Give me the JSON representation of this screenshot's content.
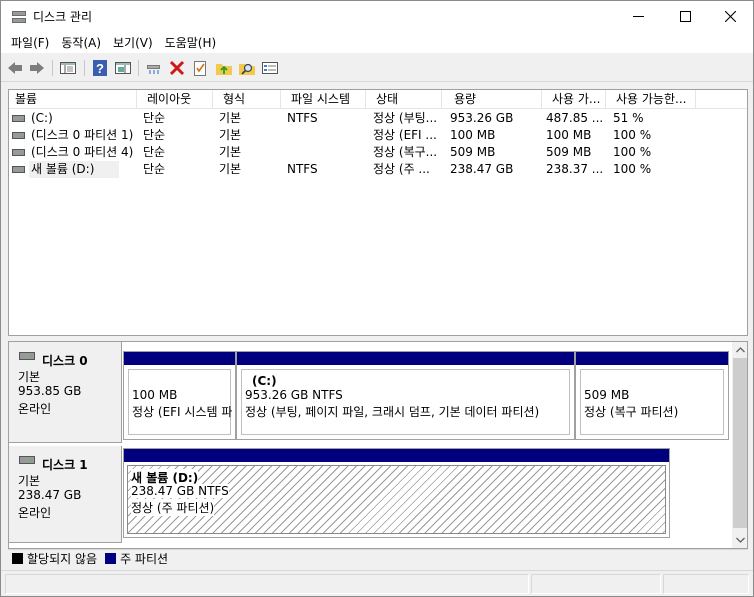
{
  "window": {
    "title": "디스크 관리"
  },
  "menu": [
    "파일(F)",
    "동작(A)",
    "보기(V)",
    "도움말(H)"
  ],
  "toolbar": {
    "buttons": [
      "back-icon",
      "forward-icon",
      "console-tree-icon",
      "help-icon",
      "action-pane-icon",
      "connect-drive-icon",
      "delete-icon",
      "checklist-icon",
      "up-folder-icon",
      "search-icon",
      "properties-icon"
    ]
  },
  "volume_list": {
    "columns": [
      "볼륨",
      "레이아웃",
      "형식",
      "파일 시스템",
      "상태",
      "용량",
      "사용 가...",
      "사용 가능한..."
    ],
    "rows": [
      {
        "volume": "(C:)",
        "layout": "단순",
        "type": "기본",
        "fs": "NTFS",
        "status": "정상 (부팅...",
        "capacity": "953.26 GB",
        "free": "487.85 ...",
        "pct": "51 %"
      },
      {
        "volume": "(디스크 0 파티션 1)",
        "layout": "단순",
        "type": "기본",
        "fs": "",
        "status": "정상 (EFI ...",
        "capacity": "100 MB",
        "free": "100 MB",
        "pct": "100 %"
      },
      {
        "volume": "(디스크 0 파티션 4)",
        "layout": "단순",
        "type": "기본",
        "fs": "",
        "status": "정상 (복구...",
        "capacity": "509 MB",
        "free": "509 MB",
        "pct": "100 %"
      },
      {
        "volume": "새 볼륨 (D:)",
        "layout": "단순",
        "type": "기본",
        "fs": "NTFS",
        "status": "정상 (주 ...",
        "capacity": "238.47 GB",
        "free": "238.37 ...",
        "pct": "100 %"
      }
    ]
  },
  "disks": [
    {
      "name": "디스크 0",
      "type": "기본",
      "size": "953.85 GB",
      "state": "온라인",
      "partitions": [
        {
          "title": "",
          "size": "100 MB",
          "status": "정상 (EFI 시스템 파티션)"
        },
        {
          "title": "(C:)",
          "size": "953.26 GB NTFS",
          "status": "정상 (부팅, 페이지 파일, 크래시 덤프, 기본 데이터 파티션)"
        },
        {
          "title": "",
          "size": "509 MB",
          "status": "정상 (복구 파티션)"
        }
      ]
    },
    {
      "name": "디스크 1",
      "type": "기본",
      "size": "238.47 GB",
      "state": "온라인",
      "partitions": [
        {
          "title": "새 볼륨  (D:)",
          "size": "238.47 GB NTFS",
          "status": "정상 (주 파티션)"
        }
      ]
    }
  ],
  "legend": [
    {
      "label": "할당되지 않음",
      "color": "#000000"
    },
    {
      "label": "주 파티션",
      "color": "#00007e"
    }
  ],
  "colors": {
    "primary_partition": "#00007e",
    "unallocated": "#000000"
  }
}
